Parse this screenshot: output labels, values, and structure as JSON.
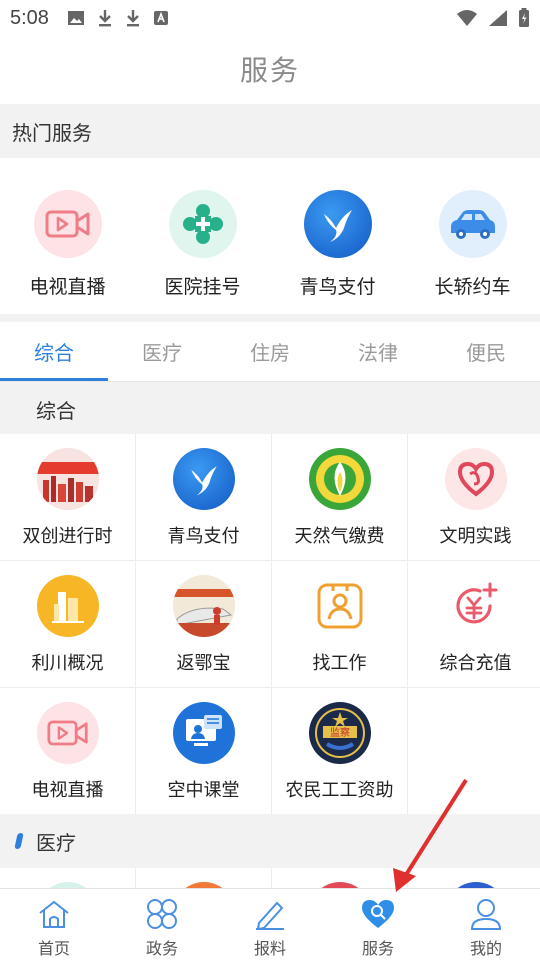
{
  "status_bar": {
    "time": "5:08"
  },
  "header": {
    "title": "服务"
  },
  "hot_services": {
    "title": "热门服务",
    "items": [
      {
        "label": "电视直播",
        "icon": "tv-live-icon"
      },
      {
        "label": "医院挂号",
        "icon": "hospital-icon"
      },
      {
        "label": "青鸟支付",
        "icon": "bluebird-pay-icon"
      },
      {
        "label": "长轿约车",
        "icon": "car-icon"
      }
    ]
  },
  "tabs": [
    {
      "label": "综合",
      "active": true
    },
    {
      "label": "医疗",
      "active": false
    },
    {
      "label": "住房",
      "active": false
    },
    {
      "label": "法律",
      "active": false
    },
    {
      "label": "便民",
      "active": false
    }
  ],
  "sections": {
    "general": {
      "title": "综合"
    },
    "medical": {
      "title": "医疗"
    }
  },
  "general_items": [
    {
      "label": "双创进行时",
      "icon": "innovation-banner-icon"
    },
    {
      "label": "青鸟支付",
      "icon": "bluebird-pay-icon"
    },
    {
      "label": "天然气缴费",
      "icon": "gas-flame-icon"
    },
    {
      "label": "文明实践",
      "icon": "heart-icon"
    },
    {
      "label": "利川概况",
      "icon": "city-building-icon"
    },
    {
      "label": "返鄂宝",
      "icon": "train-banner-icon"
    },
    {
      "label": "找工作",
      "icon": "job-search-icon"
    },
    {
      "label": "综合充值",
      "icon": "recharge-icon"
    },
    {
      "label": "电视直播",
      "icon": "tv-live-icon"
    },
    {
      "label": "空中课堂",
      "icon": "online-class-icon"
    },
    {
      "label": "农民工工资助",
      "icon": "labor-badge-icon"
    }
  ],
  "badge_text": "监察",
  "bottom_nav": [
    {
      "label": "首页",
      "icon": "home-icon",
      "active": false
    },
    {
      "label": "政务",
      "icon": "government-icon",
      "active": false
    },
    {
      "label": "报料",
      "icon": "report-pen-icon",
      "active": false
    },
    {
      "label": "服务",
      "icon": "service-heart-icon",
      "active": true
    },
    {
      "label": "我的",
      "icon": "profile-icon",
      "active": false
    }
  ],
  "colors": {
    "accent": "#2f7fde",
    "tv_pink": "#ef7c86",
    "hospital_green": "#27b089",
    "gas_green": "#3aa63a",
    "heart_red": "#e0475a",
    "job_orange": "#f0a030",
    "bluebird": "#1f73d8"
  }
}
